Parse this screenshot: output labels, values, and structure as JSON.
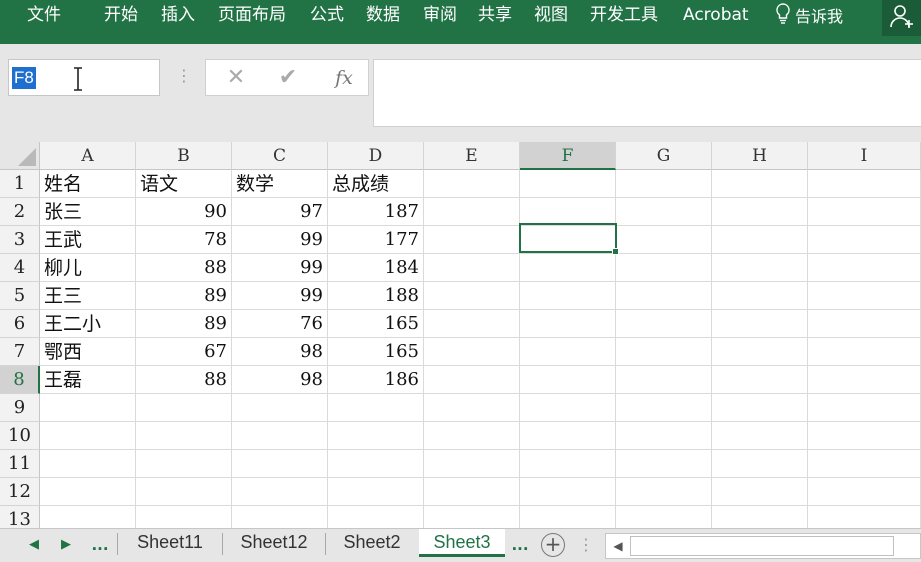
{
  "ribbon": {
    "tabs": [
      "文件",
      "开始",
      "插入",
      "页面布局",
      "公式",
      "数据",
      "审阅",
      "共享",
      "视图",
      "开发工具",
      "Acrobat"
    ],
    "tell_me": "告诉我",
    "accent_color": "#217346",
    "share_icon": "add-person-icon"
  },
  "formula_bar": {
    "name_box": "F8",
    "dots": "⋮",
    "cancel": "✕",
    "enter": "✔",
    "fx": "fx",
    "formula": ""
  },
  "grid": {
    "columns": [
      "A",
      "B",
      "C",
      "D",
      "E",
      "F",
      "G",
      "H",
      "I"
    ],
    "selected_column": "F",
    "selected_row": "8",
    "row_numbers": [
      "1",
      "2",
      "3",
      "4",
      "5",
      "6",
      "7",
      "8",
      "9",
      "10",
      "11",
      "12",
      "13"
    ],
    "rows": [
      [
        "姓名",
        "语文",
        "数学",
        "总成绩"
      ],
      [
        "张三",
        "90",
        "97",
        "187"
      ],
      [
        "王武",
        "78",
        "99",
        "177"
      ],
      [
        "柳儿",
        "88",
        "99",
        "184"
      ],
      [
        "王三",
        "89",
        "99",
        "188"
      ],
      [
        "王二小",
        "89",
        "76",
        "165"
      ],
      [
        "鄂西",
        "67",
        "98",
        "165"
      ],
      [
        "王磊",
        "88",
        "98",
        "186"
      ]
    ]
  },
  "sheet_tabs": {
    "prev": "◀",
    "next": "▶",
    "more_left": "...",
    "tabs": [
      "Sheet11",
      "Sheet12",
      "Sheet2",
      "Sheet3"
    ],
    "active": "Sheet3",
    "more_right": "...",
    "add": "+",
    "scroll_left": "◀",
    "more_dots": "⋮"
  }
}
